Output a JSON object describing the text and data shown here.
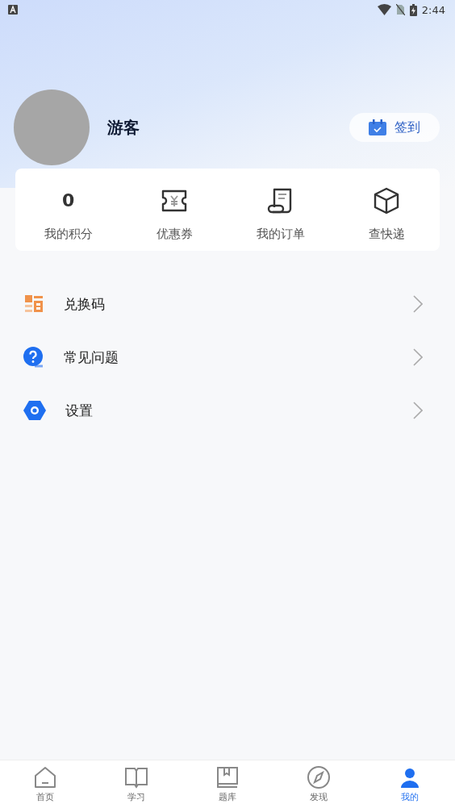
{
  "status_bar": {
    "time": "2:44"
  },
  "profile": {
    "name": "游客",
    "checkin_button": "签到"
  },
  "stats": [
    {
      "kind": "number",
      "value": "0",
      "label": "我的积分"
    },
    {
      "kind": "coupon",
      "label": "优惠券"
    },
    {
      "kind": "order",
      "label": "我的订单"
    },
    {
      "kind": "package",
      "label": "查快递"
    }
  ],
  "menu": [
    {
      "kind": "code",
      "label": "兑换码"
    },
    {
      "kind": "faq",
      "label": "常见问题"
    },
    {
      "kind": "settings",
      "label": "设置"
    }
  ],
  "tab_bar": [
    {
      "kind": "home",
      "label": "首页",
      "selected": false
    },
    {
      "kind": "study",
      "label": "学习",
      "selected": false
    },
    {
      "kind": "bank",
      "label": "题库",
      "selected": false
    },
    {
      "kind": "discover",
      "label": "发现",
      "selected": false
    },
    {
      "kind": "me",
      "label": "我的",
      "selected": true
    }
  ]
}
